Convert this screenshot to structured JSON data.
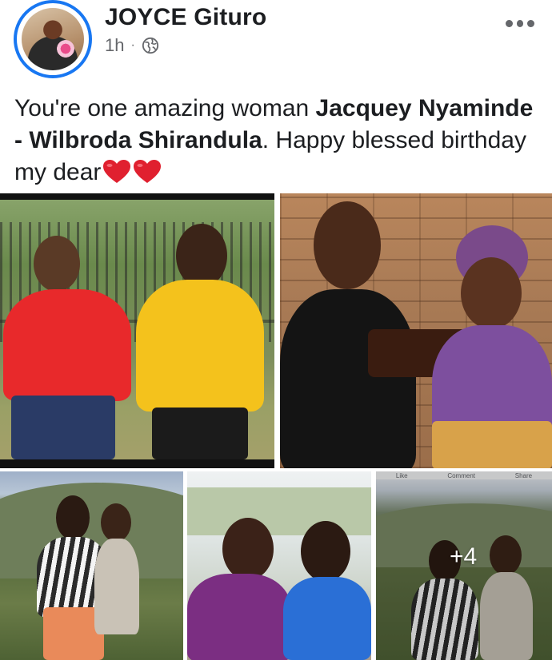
{
  "post": {
    "author": "JOYCE Gituro",
    "time": "1h",
    "separator": "·",
    "privacy_icon": "globe-icon",
    "menu_icon": "more-horizontal-icon",
    "text_part1": "You're one amazing woman ",
    "text_bold": "Jacquey Nyaminde - Wilbroda Shirandula",
    "text_part2": ". Happy blessed birthday my dear",
    "emoji": [
      "heart-icon",
      "heart-icon"
    ]
  },
  "photos": {
    "count": 5,
    "more_label": "+4",
    "tile5_bar": {
      "like": "Like",
      "comment": "Comment",
      "share": "Share"
    }
  },
  "colors": {
    "accent": "#1877f2",
    "text": "#1c1e21",
    "meta": "#65676b",
    "heart": "#e0202f"
  }
}
